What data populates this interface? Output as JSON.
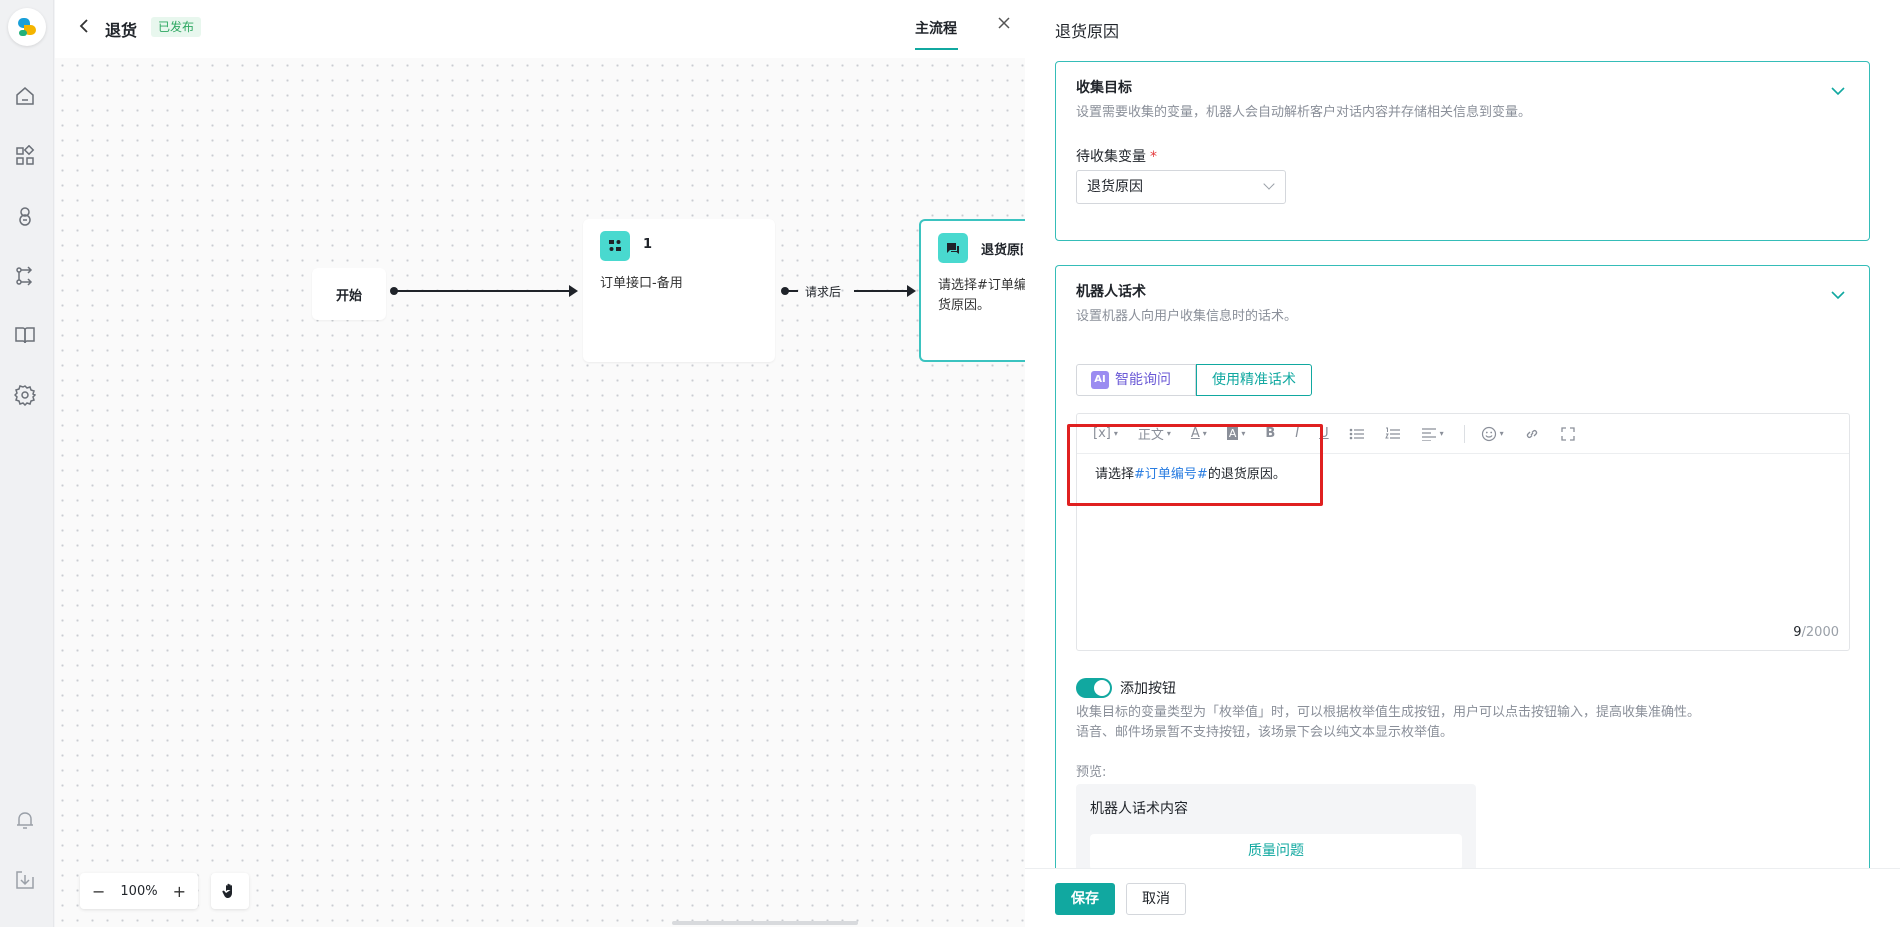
{
  "header": {
    "back_icon": "chevron-left-icon",
    "title": "退货",
    "status_badge": "已发布",
    "tab": "主流程",
    "close_icon": "close-icon"
  },
  "rail": {
    "icons": [
      "logo",
      "home-icon",
      "apps-icon",
      "robot-icon",
      "flow-icon",
      "book-icon",
      "gear-icon",
      "bell-icon",
      "download-icon"
    ]
  },
  "flow": {
    "start_node": "开始",
    "api_node": {
      "title": "1",
      "body": "订单接口-备用"
    },
    "edge_label": "请求后",
    "collect_node": {
      "title": "退货原因",
      "body_line1": "请选择#订单编",
      "body_line2": "货原因。"
    }
  },
  "zoom": {
    "minus": "−",
    "level": "100%",
    "plus": "+"
  },
  "panel": {
    "title": "退货原因",
    "collect_goal": {
      "title": "收集目标",
      "desc": "设置需要收集的变量，机器人会自动解析客户对话内容并存储相关信息到变量。",
      "var_label": "待收集变量",
      "required_mark": "*",
      "var_value": "退货原因"
    },
    "robot_script": {
      "title": "机器人话术",
      "desc": "设置机器人向用户收集信息时的话术。",
      "tab_ai": "智能询问",
      "tab_ai_badge": "AI",
      "tab_precise": "使用精准话术",
      "toolbar": {
        "var": "[x]",
        "para": "正文",
        "font_color": "A",
        "bg_color": "A",
        "bold": "B",
        "italic": "I",
        "underline": "U"
      },
      "text_before": "请选择",
      "text_var": "#订单编号#",
      "text_after": "的退货原因。",
      "count": "9",
      "max": "/2000"
    },
    "add_button": {
      "label": "添加按钮",
      "enabled": true,
      "desc_line1": "收集目标的变量类型为「枚举值」时，可以根据枚举值生成按钮，用户可以点击按钮输入，提高收集准确性。",
      "desc_line2": "语音、邮件场景暂不支持按钮，该场景下会以纯文本显示枚举值。",
      "preview_label": "预览:",
      "preview_text": "机器人话术内容",
      "preview_button": "质量问题"
    },
    "footer": {
      "save": "保存",
      "cancel": "取消"
    }
  },
  "colors": {
    "accent": "#11a8a0",
    "highlight": "#e02020",
    "variable": "#2a7de1"
  }
}
